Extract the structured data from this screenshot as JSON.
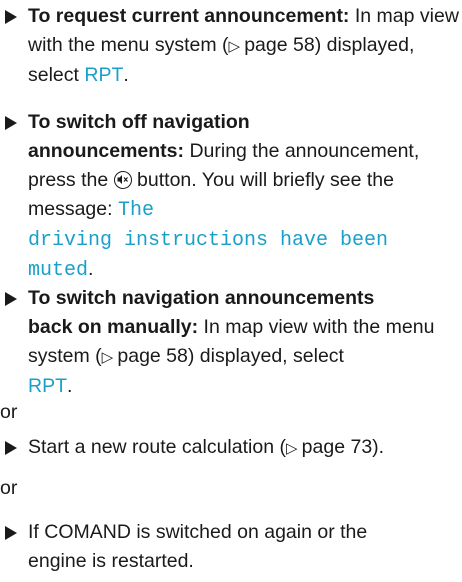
{
  "item1": {
    "lead": "To request current announcement:",
    "text_a": " In map view with the menu system (",
    "page_ref": "page 58",
    "text_b": ") displayed, select ",
    "link": "RPT",
    "text_c": "."
  },
  "item2": {
    "lead_line1": "To switch off navigation",
    "lead_line2": "announcements:",
    "text_a": " During the announcement, press the ",
    "text_b": " button. You will briefly see the message: ",
    "msg_line1": "The",
    "msg_line2": "driving instructions have been",
    "msg_line3": "muted",
    "text_c": "."
  },
  "item3": {
    "lead_line1": "To switch navigation announcements",
    "lead_line2": "back on manually:",
    "text_a": " In map view with the menu system (",
    "page_ref": "page 58",
    "text_b": ") displayed, select",
    "link": "RPT",
    "text_c": "."
  },
  "or1": "or",
  "item4": {
    "text_a": "Start a new route calculation (",
    "page_ref": "page 73",
    "text_b": ")."
  },
  "or2": "or",
  "item5": {
    "line1": "If COMAND is switched on again or the",
    "line2": "engine is restarted."
  },
  "icons": {
    "bullet": "triangle-bullet-icon",
    "page_ref": "page-reference-arrow-icon",
    "mute": "mute-button-icon"
  },
  "colors": {
    "accent": "#1aa0c8",
    "text": "#1a1a1a"
  }
}
